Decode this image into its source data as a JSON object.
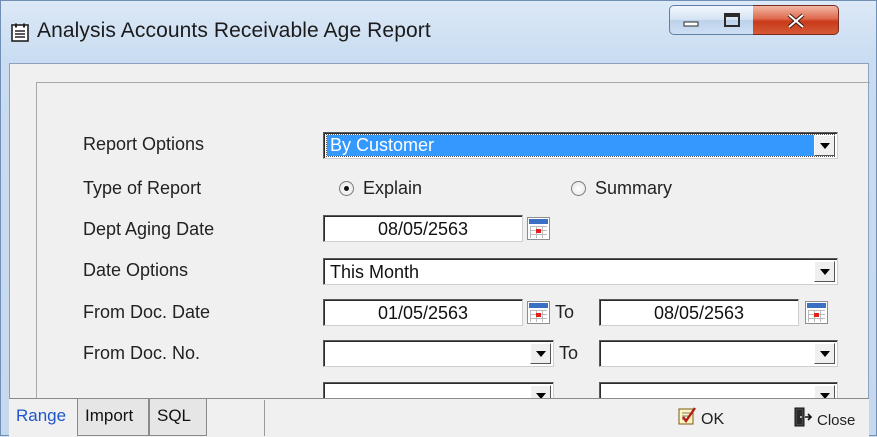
{
  "window": {
    "title": "Analysis Accounts Receivable Age Report"
  },
  "form": {
    "report_options": {
      "label": "Report Options",
      "value": "By Customer"
    },
    "type_of_report": {
      "label": "Type of Report",
      "options": [
        "Explain",
        "Summary"
      ],
      "selected": "Explain"
    },
    "dept_aging_date": {
      "label": "Dept Aging Date",
      "value": "08/05/2563"
    },
    "date_options": {
      "label": "Date Options",
      "value": "This Month"
    },
    "from_doc_date": {
      "label": "From Doc. Date",
      "from": "01/05/2563",
      "to_label": "To",
      "to": "08/05/2563"
    },
    "from_doc_no": {
      "label": "From Doc. No.",
      "from": "",
      "to_label": "To",
      "to": ""
    }
  },
  "tabs": [
    "Range",
    "Import",
    "SQL"
  ],
  "active_tab": "Range",
  "toolbar": {
    "ok_label": "OK",
    "close_label": "Close"
  },
  "colors": {
    "accent": "#3399ff",
    "active_tab": "#1f56c9",
    "close_button": "#c83a1a"
  }
}
